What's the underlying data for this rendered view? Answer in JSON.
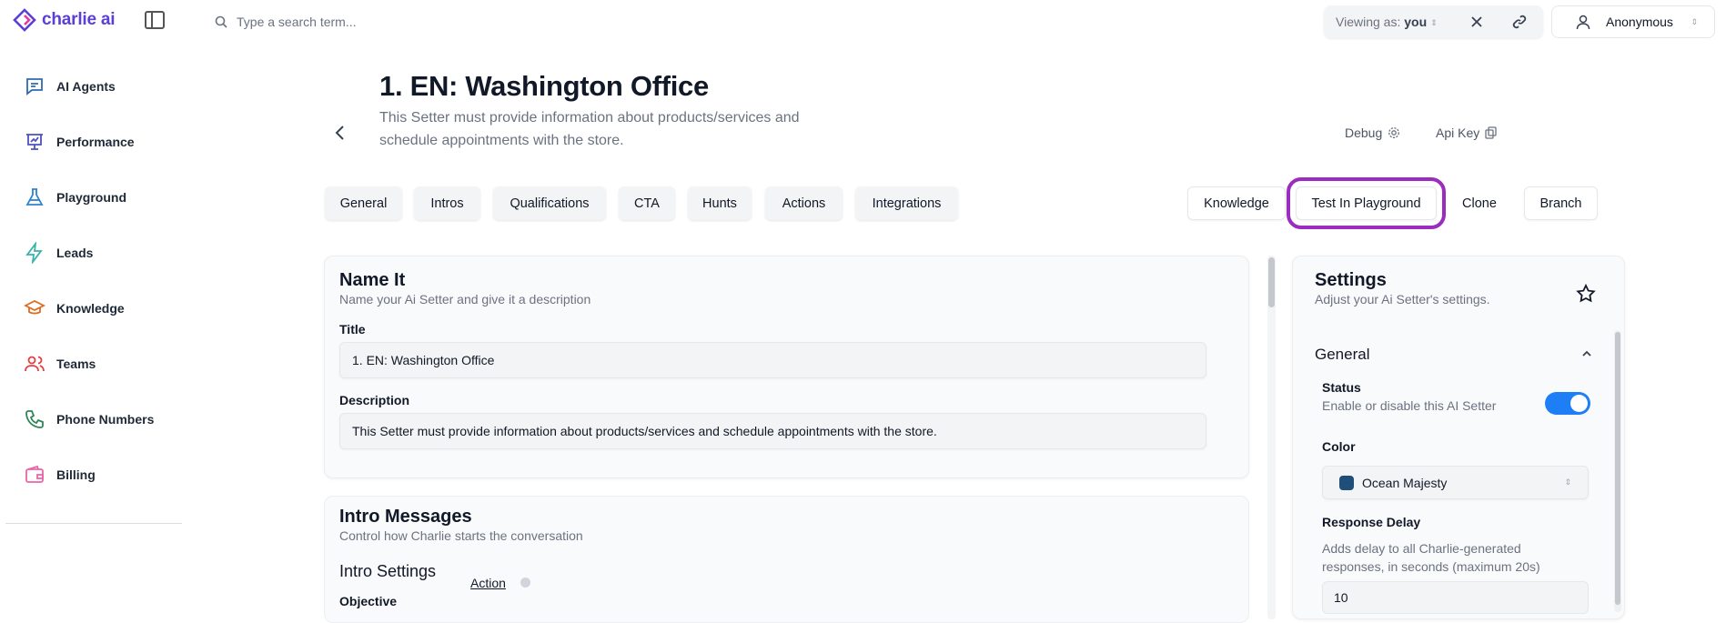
{
  "brand": {
    "name": "charlie ai",
    "accent": "#5b3fd6"
  },
  "sidebar": {
    "items": [
      {
        "label": "AI Agents",
        "icon": "chat-icon",
        "color": "#2b6cb0"
      },
      {
        "label": "Performance",
        "icon": "presentation-chart-icon",
        "color": "#4c51bf"
      },
      {
        "label": "Playground",
        "icon": "flask-icon",
        "color": "#3182ce"
      },
      {
        "label": "Leads",
        "icon": "lightning-icon",
        "color": "#38b2ac"
      },
      {
        "label": "Knowledge",
        "icon": "graduation-cap-icon",
        "color": "#dd6b20"
      },
      {
        "label": "Teams",
        "icon": "users-icon",
        "color": "#e53e3e"
      },
      {
        "label": "Phone Numbers",
        "icon": "phone-icon",
        "color": "#2f855a"
      },
      {
        "label": "Billing",
        "icon": "wallet-icon",
        "color": "#ed64a6"
      }
    ]
  },
  "topbar": {
    "search_placeholder": "Type a search term...",
    "viewing_prefix": "Viewing as:",
    "viewing_value": "you",
    "user_name": "Anonymous"
  },
  "header": {
    "title": "1. EN: Washington Office",
    "description": "This Setter must provide information about products/services and schedule appointments with the store.",
    "debug_label": "Debug",
    "apikey_label": "Api Key"
  },
  "tabs": {
    "left": [
      "General",
      "Intros",
      "Qualifications",
      "CTA",
      "Hunts",
      "Actions",
      "Integrations"
    ],
    "right": [
      "Knowledge",
      "Test In Playground",
      "Clone",
      "Branch"
    ],
    "highlight_color": "#9b2cbf"
  },
  "name_it": {
    "heading": "Name It",
    "subheading": "Name your Ai Setter and give it a description",
    "title_label": "Title",
    "title_value": "1. EN: Washington Office",
    "description_label": "Description",
    "description_value": "This Setter must provide information about products/services and schedule appointments with the store."
  },
  "intro": {
    "heading": "Intro Messages",
    "subheading": "Control how Charlie starts the conversation",
    "settings_heading": "Intro Settings",
    "action_link": "Action",
    "objective_label": "Objective"
  },
  "settings": {
    "heading": "Settings",
    "subheading": "Adjust your Ai Setter's settings.",
    "group_title": "General",
    "status_label": "Status",
    "status_desc": "Enable or disable this AI Setter",
    "status_enabled": true,
    "toggle_color": "#1d7ef5",
    "color_label": "Color",
    "color_value": "Ocean Majesty",
    "color_swatch": "#1f4e79",
    "delay_label": "Response Delay",
    "delay_desc": "Adds delay to all Charlie-generated responses, in seconds (maximum 20s)",
    "delay_value": "10"
  }
}
